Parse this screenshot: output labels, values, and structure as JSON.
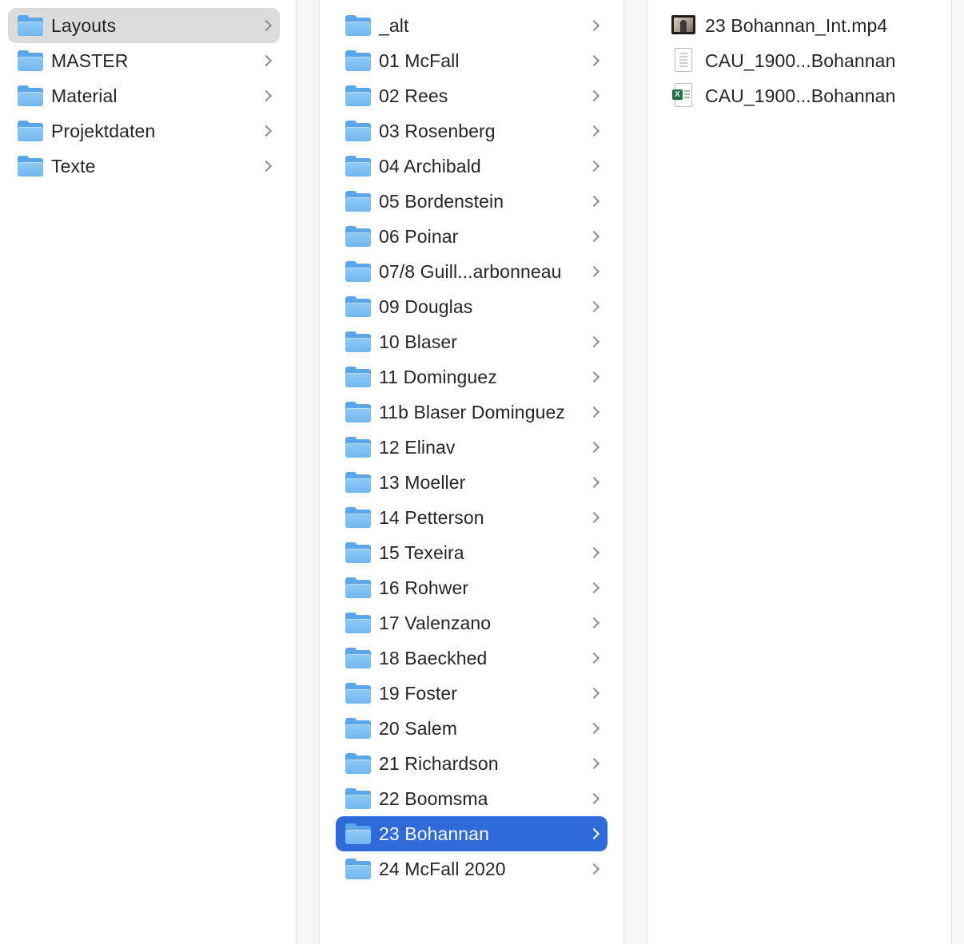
{
  "column1": {
    "items": [
      {
        "label": "Layouts",
        "selected": "grey"
      },
      {
        "label": "MASTER"
      },
      {
        "label": "Material"
      },
      {
        "label": "Projektdaten"
      },
      {
        "label": "Texte"
      }
    ]
  },
  "column2": {
    "items": [
      {
        "label": "_alt"
      },
      {
        "label": "01 McFall"
      },
      {
        "label": "02 Rees"
      },
      {
        "label": "03 Rosenberg"
      },
      {
        "label": "04 Archibald"
      },
      {
        "label": "05 Bordenstein"
      },
      {
        "label": "06 Poinar"
      },
      {
        "label": "07/8 Guill...arbonneau"
      },
      {
        "label": "09 Douglas"
      },
      {
        "label": "10 Blaser"
      },
      {
        "label": "11 Dominguez"
      },
      {
        "label": "11b Blaser Dominguez"
      },
      {
        "label": "12 Elinav"
      },
      {
        "label": "13 Moeller"
      },
      {
        "label": "14 Petterson"
      },
      {
        "label": "15 Texeira"
      },
      {
        "label": "16 Rohwer"
      },
      {
        "label": "17 Valenzano"
      },
      {
        "label": "18 Baeckhed"
      },
      {
        "label": "19 Foster"
      },
      {
        "label": "20 Salem"
      },
      {
        "label": "21 Richardson"
      },
      {
        "label": "22 Boomsma"
      },
      {
        "label": "23 Bohannan",
        "selected": "blue"
      },
      {
        "label": "24 McFall 2020"
      }
    ]
  },
  "column3": {
    "items": [
      {
        "label": "23 Bohannan_Int.mp4",
        "icon": "video-thumbnail-icon"
      },
      {
        "label": "CAU_1900...Bohannan",
        "icon": "document-icon"
      },
      {
        "label": "CAU_1900...Bohannan",
        "icon": "excel-file-icon"
      }
    ]
  },
  "colors": {
    "selection_blue": "#2f6ad9",
    "selection_grey": "#dcdcdc",
    "folder_blue": "#72b6f0"
  }
}
